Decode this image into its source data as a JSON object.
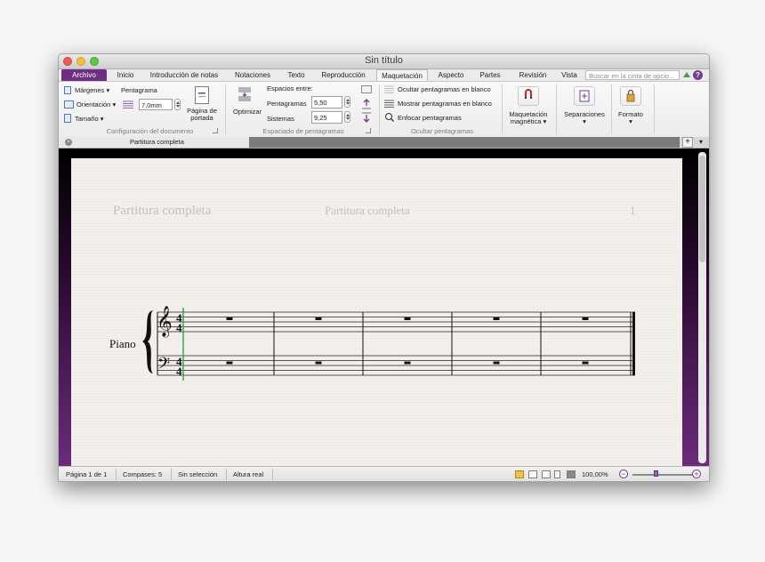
{
  "window": {
    "title": "Sin título"
  },
  "tabs": [
    {
      "label": "Archivo"
    },
    {
      "label": "Inicio"
    },
    {
      "label": "Introducción de notas"
    },
    {
      "label": "Notaciones"
    },
    {
      "label": "Texto"
    },
    {
      "label": "Reproducción"
    },
    {
      "label": "Maquetación"
    },
    {
      "label": "Aspecto"
    },
    {
      "label": "Partes"
    },
    {
      "label": "Revisión"
    },
    {
      "label": "Vista"
    }
  ],
  "search": {
    "placeholder": "Buscar en la cinta de opcio..."
  },
  "ribbon": {
    "documento": {
      "margenes": "Márgenes",
      "pentagrama_label": "Pentagrama",
      "orientacion": "Orientación",
      "pentagrama_value": "7,0mm",
      "tamano": "Tamaño",
      "pagina_portada_1": "Página de",
      "pagina_portada_2": "portada",
      "group_label": "Configuración del documento"
    },
    "espaciado": {
      "optimizar": "Optimizar",
      "espacios_entre": "Espacios entre:",
      "pentagramas_label": "Pentagramas",
      "pentagramas_value": "5,50",
      "sistemas_label": "Sistemas",
      "sistemas_value": "9,25",
      "group_label": "Espaciado de pentagramas"
    },
    "ocultar": {
      "ocultar_blanco": "Ocultar pentagramas en blanco",
      "mostrar_blanco": "Mostrar pentagramas en blanco",
      "enfocar": "Enfocar pentagramas",
      "group_label": "Ocultar pentagramas"
    },
    "maquetacion_magnetica_1": "Maquetación",
    "maquetacion_magnetica_2": "magnética",
    "separaciones": "Separaciones",
    "formato": "Formato"
  },
  "doc_tab": {
    "label": "Partitura completa"
  },
  "score": {
    "header_left": "Partitura completa",
    "header_center": "Partitura completa",
    "page_number": "1",
    "instrument": "Piano",
    "time_signature": {
      "top": "4",
      "bottom": "4"
    },
    "measures": 5
  },
  "status": {
    "page": "Página 1 de 1",
    "compases": "Compases: 5",
    "seleccion": "Sin selección",
    "altura": "Altura real",
    "zoom": "100,00%"
  },
  "colors": {
    "accent": "#6d2e83",
    "cursor": "#3aa54a"
  }
}
